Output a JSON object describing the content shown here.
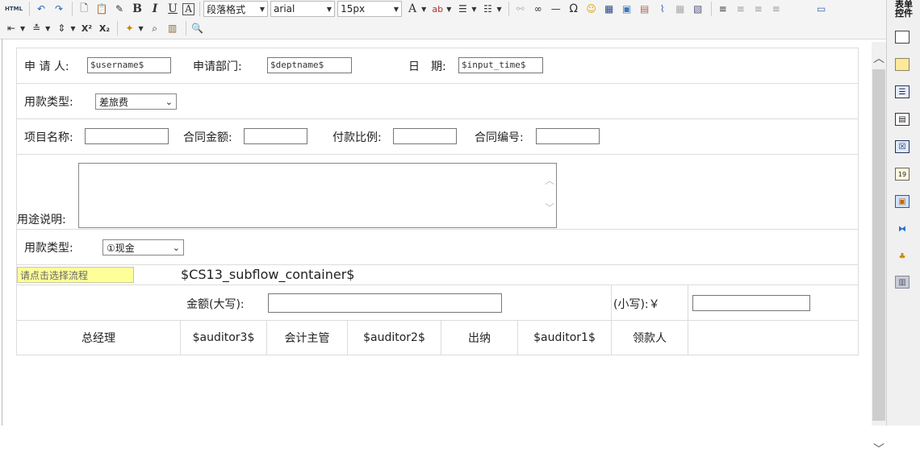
{
  "toolbar": {
    "html_label": "HTML",
    "bold_label": "B",
    "italic_label": "I",
    "underline_label": "U",
    "box_a_label": "A",
    "paragraph_format": "段落格式",
    "font_family": "arial",
    "font_size": "15px",
    "font_color_label": "A",
    "highlight_label": "ab",
    "omega_label": "Ω",
    "superscript_label": "X²",
    "subscript_label": "X₂"
  },
  "right_panel": {
    "title_line1": "表单",
    "title_line2": "控件"
  },
  "form": {
    "row1": {
      "applicant_label": "申 请 人:",
      "applicant_value": "$username$",
      "dept_label": "申请部门:",
      "dept_value": "$deptname$",
      "date_label": "日　期:",
      "date_value": "$input_time$"
    },
    "row2": {
      "payment_type_label": "用款类型:",
      "payment_type_value": "差旅费"
    },
    "row3": {
      "project_label": "项目名称:",
      "project_value": "",
      "amount_label": "合同金额:",
      "amount_value": "",
      "ratio_label": "付款比例:",
      "ratio_value": "",
      "contract_no_label": "合同编号:",
      "contract_no_value": ""
    },
    "row4": {
      "purpose_label": "用途说明:"
    },
    "row5": {
      "payment_type_label": "用款类型:",
      "payment_type_value": "①现金"
    },
    "row6": {
      "flow_button": "请点击选择流程",
      "subflow": "$CS13_subflow_container$"
    },
    "row7": {
      "amount_upper_label": "金额(大写):",
      "amount_lower_label": "(小写):￥"
    },
    "row8": {
      "gm_label": "总经理",
      "auditor3": "$auditor3$",
      "accounting_label": "会计主管",
      "auditor2": "$auditor2$",
      "cashier_label": "出纳",
      "auditor1": "$auditor1$",
      "receiver_label": "领款人"
    }
  }
}
